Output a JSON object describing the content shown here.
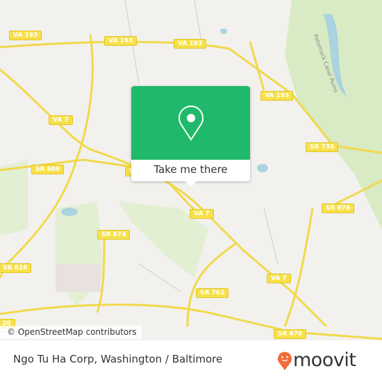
{
  "map": {
    "road_labels": [
      "VA 193",
      "VA 193",
      "VA 193",
      "VA 193",
      "VA 7",
      "VA 7",
      "VA 7",
      "VA",
      "SR 606",
      "SR 674",
      "SR 828",
      "SR 702",
      "SR 738",
      "SR 676",
      "SR 676",
      "20"
    ],
    "place_label": "Potomack Canal Ruins",
    "attribution": "© OpenStreetMap contributors",
    "colors": {
      "land": "#f2f1ee",
      "park": "#d9ebc4",
      "water": "#aad3df",
      "road": "#f7e04a"
    }
  },
  "popup": {
    "button_label": "Take me there",
    "icon": "map-pin-icon",
    "color": "#20b96b"
  },
  "footer": {
    "title": "Ngo Tu Ha Corp, Washington / Baltimore",
    "logo": "moovit",
    "logo_color": "#f26b3a"
  }
}
